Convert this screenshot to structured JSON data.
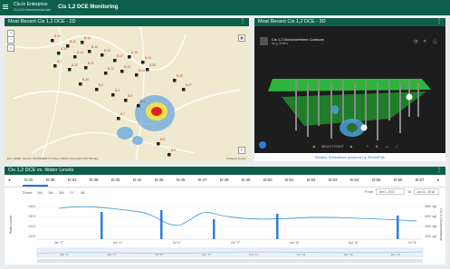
{
  "app": {
    "logo_line1": "Clu-In Enterprise",
    "logo_line2": "CLU-IN environmental site",
    "title": "Cis 1,2 DCE Monitoring"
  },
  "map_panel": {
    "title": "Most Recent Cis 1,2 DCE - 2D",
    "attribution": "Esri, HERE, Garmin, INCREMENT P, NGA, USGS | Copyright 2017 Bentley",
    "powered": "Powered by Esri",
    "well_labels": [
      "B-10",
      "B-11",
      "B-12",
      "B-13",
      "B-14",
      "B-15",
      "B-16",
      "B-17",
      "B-18",
      "B-19",
      "B-2",
      "B-20",
      "B-21",
      "B-22",
      "B-23",
      "B-24",
      "B-25",
      "B-26",
      "B-27",
      "B-28",
      "B-3",
      "B-4",
      "B-5",
      "B-6",
      "B-7",
      "B-8",
      "B-9"
    ]
  },
  "td_panel": {
    "title": "Most Recent Cis 1,2 DCE - 3D",
    "model_name": "Cis 1,2 Dichloroethene Contours",
    "model_sub": "by g_enterz",
    "embed_label": "Bentley Subsurface powered by SketchFab",
    "player_label": "SELECT POINT"
  },
  "chart_panel": {
    "title": "Cis 1,2 DCE vs. Water Levels",
    "tabs": [
      "B-30",
      "B-38",
      "B-33",
      "B-39",
      "B-35",
      "B-42",
      "B-45",
      "B-46",
      "B-47",
      "B-48",
      "B-49",
      "B-50",
      "B-51",
      "B-52",
      "B-53",
      "B-54",
      "B-55",
      "B-56",
      "B-57"
    ],
    "zoom_label": "Zoom",
    "zoom_options": [
      "1M",
      "1M",
      "3M",
      "1Y",
      "All"
    ],
    "from_label": "From",
    "from_value": "Jan 1, 2017",
    "to_label": "To",
    "to_value": "Jun 11, 2018",
    "y_left_label": "Water Levels",
    "y_right_label": "Cis 1,2 Dichloroethene",
    "y_left_ticks": [
      "128 ft",
      "126 ft",
      "124 ft",
      "122 ft"
    ],
    "y_right_ticks": [
      "8000 ug/L",
      "6000 ug/L",
      "4000 ug/L",
      "2000 ug/L"
    ],
    "x_ticks": [
      "Jan '17",
      "Apr '17",
      "Jul '17",
      "Oct '17",
      "Jan '18",
      "Apr '18",
      "Jul '18"
    ],
    "nav_ticks": [
      "Mar '17",
      "May '17",
      "Jul '17",
      "Sep '17",
      "Nov '17",
      "Jan '18",
      "Mar '18",
      "May '18"
    ]
  },
  "colors": {
    "header": "#0e5f4a",
    "accent": "#1a73e8",
    "plume_high": "#e02020",
    "plume_low": "#5a9bd8"
  }
}
